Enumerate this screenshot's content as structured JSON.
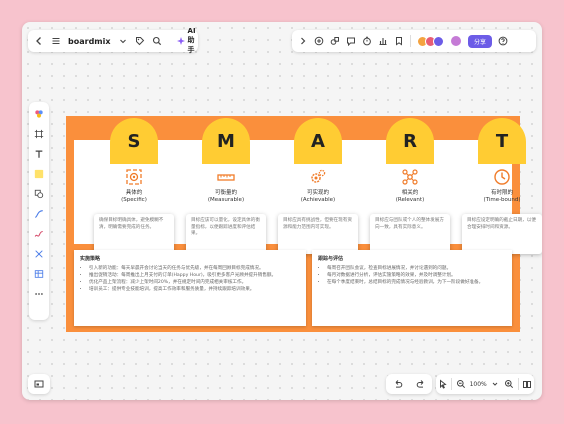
{
  "app": {
    "name": "boardmix",
    "ai_label": "AI助手",
    "share_label": "分享"
  },
  "zoom": {
    "level": "100%"
  },
  "colors": {
    "board": "#fa8f3c",
    "tab": "#ffcc33",
    "icon": "#f07c2a",
    "share": "#6c5ce7",
    "background": "#f7c3cd"
  },
  "smart": [
    {
      "letter": "S",
      "title_cn": "具体的",
      "title_en": "(Specific)",
      "desc": "确保目标明确具体，避免模糊不清，明确需要完成的任务。"
    },
    {
      "letter": "M",
      "title_cn": "可衡量的",
      "title_en": "(Measurable)",
      "desc": "目标应该可以量化，设定具体的衡量指标，以便跟踪进度和评估结果。"
    },
    {
      "letter": "A",
      "title_cn": "可实现的",
      "title_en": "(Achievable)",
      "desc": "目标应具有挑战性，但要在现有资源和能力范围内可实现。"
    },
    {
      "letter": "R",
      "title_cn": "相关的",
      "title_en": "(Relevant)",
      "desc": "目标应与团队或个人的整体发展方向一致，具有实际意义。"
    },
    {
      "letter": "T",
      "title_cn": "有时限的",
      "title_en": "(Time-bound)",
      "desc": "目标应设定明确的截止日期，以便合理安排时间和资源。"
    }
  ],
  "panels": {
    "left": {
      "title": "实施策略",
      "items": [
        "引入新的功能：每天早晨开会讨论当天的任务与优先级，并在每周回顾目标完成情况。",
        "推出促销活动：每周推出上月支付的订单(Happy Hour)，吸引更多客户光顾并提升销售额。",
        "优化产品上架流程：减少上架时间20%，并在规定时间内完成相关审核工作。",
        "培训员工：提供专业技能培训，提高工作效率和服务质量，并持续跟踪培训效果。"
      ]
    },
    "right": {
      "title": "跟踪与评估",
      "items": [
        "每周召开团队会议，检查目标进展情况，并讨论遇到的问题。",
        "每月对数据进行分析，评估实施策略的效果，并及时调整计划。",
        "在每个季度结束时，总结目标的完成情况与经验教训，为下一阶段做好准备。"
      ]
    }
  }
}
